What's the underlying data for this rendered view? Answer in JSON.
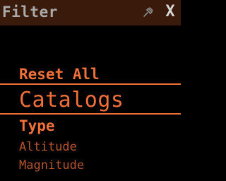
{
  "window": {
    "title": "Filter",
    "close_label": "X",
    "pin_icon": "pin-icon"
  },
  "menu": {
    "reset_all": "Reset All",
    "catalogs": "Catalogs",
    "type": "Type",
    "options": [
      "Altitude",
      "Magnitude"
    ]
  },
  "colors": {
    "accent": "#f0703a",
    "accent_dim": "#b85530",
    "titlebar": "#3a1a0a",
    "title_text": "#aaaaaa",
    "background": "#000000"
  }
}
